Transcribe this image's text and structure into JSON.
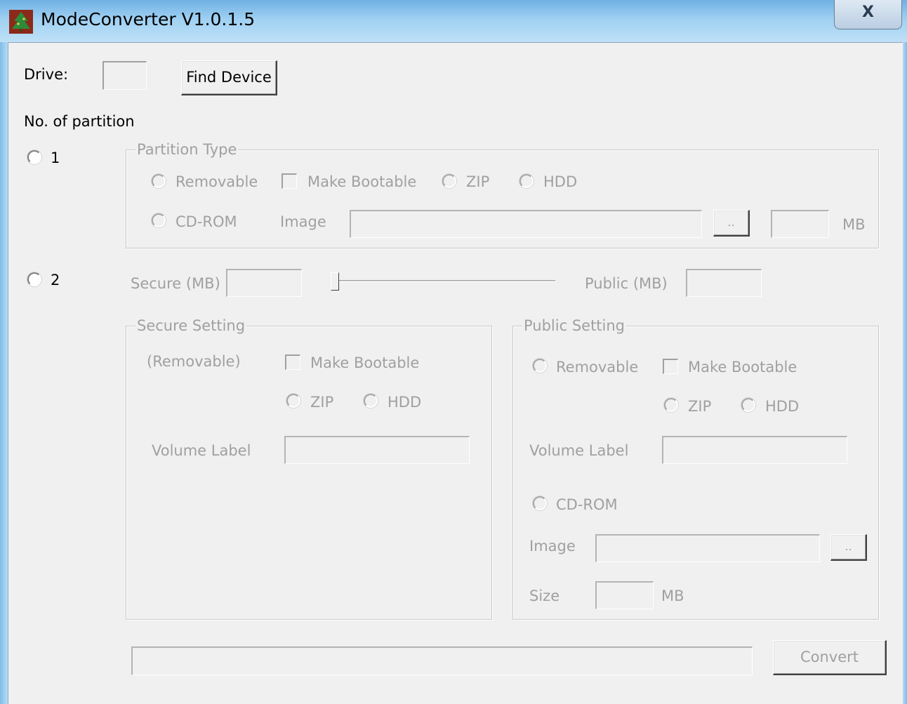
{
  "window": {
    "title": "ModeConverter V1.0.1.5",
    "close_glyph": "X",
    "app_icon": "tree-app-icon"
  },
  "drive": {
    "label": "Drive:",
    "value": "",
    "find_button": "Find Device"
  },
  "partition": {
    "heading": "No. of partition",
    "option1_label": "1",
    "option2_label": "2"
  },
  "partition_type": {
    "legend": "Partition Type",
    "removable": "Removable",
    "make_bootable": "Make Bootable",
    "zip": "ZIP",
    "hdd": "HDD",
    "cdrom": "CD-ROM",
    "image_label": "Image",
    "image_value": "",
    "browse": "..",
    "size_value": "",
    "unit": "MB"
  },
  "split": {
    "secure_label": "Secure (MB)",
    "secure_value": "",
    "public_label": "Public (MB)",
    "public_value": "",
    "slider_level": 0
  },
  "secure_setting": {
    "legend": "Secure Setting",
    "removable_note": "(Removable)",
    "make_bootable": "Make Bootable",
    "zip": "ZIP",
    "hdd": "HDD",
    "volume_label": "Volume Label",
    "volume_value": ""
  },
  "public_setting": {
    "legend": "Public Setting",
    "removable": "Removable",
    "make_bootable": "Make Bootable",
    "zip": "ZIP",
    "hdd": "HDD",
    "volume_label": "Volume Label",
    "volume_value": "",
    "cdrom": "CD-ROM",
    "image_label": "Image",
    "image_value": "",
    "browse": "..",
    "size_label": "Size",
    "size_value": "",
    "unit": "MB"
  },
  "footer": {
    "progress_text": "",
    "convert_button": "Convert"
  },
  "colors": {
    "disabled_text": "#a0a0a0",
    "face": "#f0f0f0",
    "title_gradient_top": "#6fb1e4"
  }
}
